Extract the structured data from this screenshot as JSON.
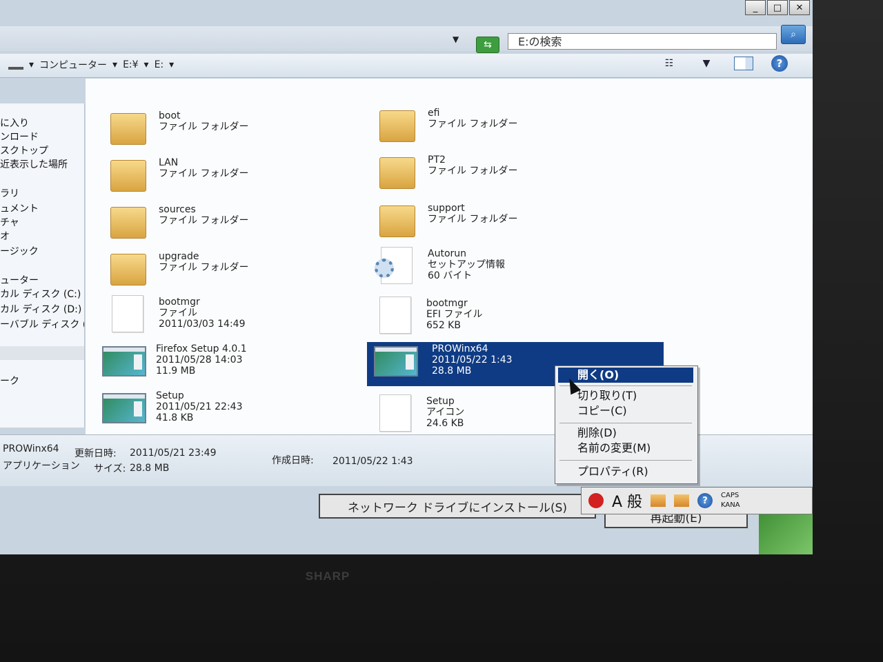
{
  "window": {
    "controls": [
      "_",
      "□",
      "✕"
    ]
  },
  "addressbar": {
    "search_placeholder": "E:の検索",
    "breadcrumb": [
      "コンピューター",
      "E:¥",
      "E:"
    ]
  },
  "nav": {
    "items": [
      "に入り",
      "ンロード",
      "スクトップ",
      "近表示した場所",
      "ラリ",
      "ュメント",
      "チャ",
      "オ",
      "ージック",
      "ューター",
      "カル ディスク (C:)",
      "カル ディスク (D:)",
      "ーバブル ディスク (E",
      "ーク"
    ]
  },
  "files": [
    {
      "name": "boot",
      "line2": "ファイル フォルダー",
      "line3": "",
      "type": "folder"
    },
    {
      "name": "efi",
      "line2": "ファイル フォルダー",
      "line3": "",
      "type": "folder"
    },
    {
      "name": "LAN",
      "line2": "ファイル フォルダー",
      "line3": "",
      "type": "folder"
    },
    {
      "name": "PT2",
      "line2": "ファイル フォルダー",
      "line3": "",
      "type": "folder"
    },
    {
      "name": "sources",
      "line2": "ファイル フォルダー",
      "line3": "",
      "type": "folder"
    },
    {
      "name": "support",
      "line2": "ファイル フォルダー",
      "line3": "",
      "type": "folder"
    },
    {
      "name": "upgrade",
      "line2": "ファイル フォルダー",
      "line3": "",
      "type": "folder"
    },
    {
      "name": "Autorun",
      "line2": "セットアップ情報",
      "line3": "60 バイト",
      "type": "config"
    },
    {
      "name": "bootmgr",
      "line2": "ファイル",
      "line3": "2011/03/03 14:49",
      "type": "blank"
    },
    {
      "name": "bootmgr",
      "line2": "EFI ファイル",
      "line3": "652 KB",
      "type": "blank"
    },
    {
      "name": "Firefox Setup 4.0.1",
      "line2": "2011/05/28 14:03",
      "line3": "11.9 MB",
      "type": "app"
    },
    {
      "name": "PROWinx64",
      "line2": "2011/05/22 1:43",
      "line3": "28.8 MB",
      "type": "app"
    },
    {
      "name": "Setup",
      "line2": "2011/05/21 22:43",
      "line3": "41.8 KB",
      "type": "app"
    },
    {
      "name": "Setup",
      "line2": "アイコン",
      "line3": "24.6 KB",
      "type": "blank"
    }
  ],
  "status": {
    "name": "PROWinx64",
    "type": "アプリケーション",
    "modified_label": "更新日時:",
    "modified_value": "2011/05/21 23:49",
    "size_label": "サイズ:",
    "size_value": "28.8 MB",
    "created_label": "作成日時:",
    "created_value": "2011/05/22 1:43"
  },
  "context_menu": {
    "items": [
      "開く(O)",
      "切り取り(T)",
      "コピー(C)",
      "削除(D)",
      "名前の変更(M)",
      "プロパティ(R)"
    ]
  },
  "dialog": {
    "install_button": "ネットワーク ドライブにインストール(S)",
    "restart_button": "再起動(E)"
  },
  "langbar": {
    "mode": "A 般",
    "caps": "CAPS",
    "kana": "KANA"
  },
  "brand": "SHARP"
}
